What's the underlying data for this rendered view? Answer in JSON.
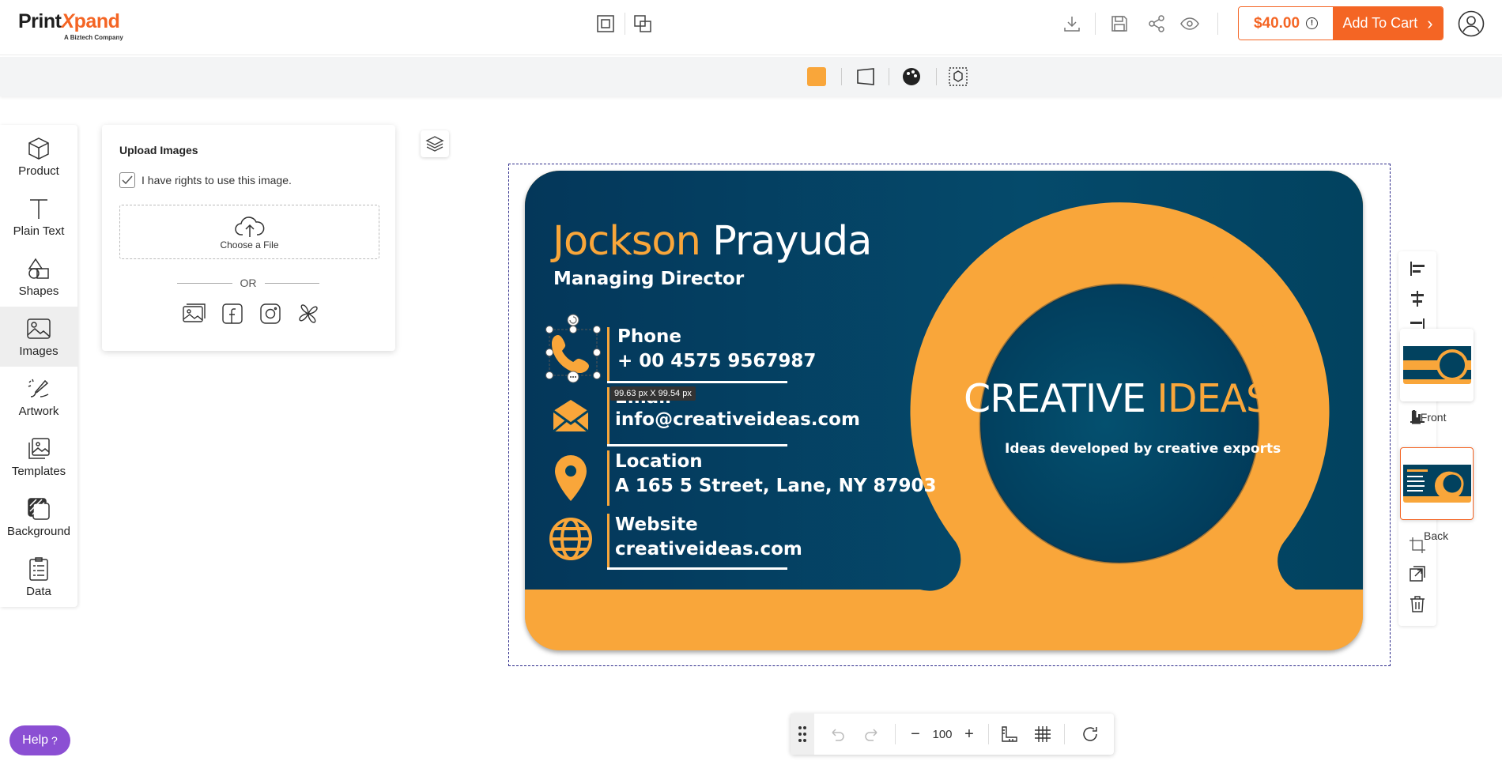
{
  "app": {
    "logo_print": "Print",
    "logo_x": "X",
    "logo_pand": "pand",
    "logo_sub": "A Biztech Company"
  },
  "header": {
    "price": "$40.00",
    "info_mark": "!",
    "cart_label": "Add To Cart",
    "cart_chevron": "›"
  },
  "sidebar": {
    "items": [
      {
        "label": "Product",
        "icon": "cube-icon"
      },
      {
        "label": "Plain Text",
        "icon": "text-icon"
      },
      {
        "label": "Shapes",
        "icon": "shapes-icon"
      },
      {
        "label": "Images",
        "icon": "image-icon"
      },
      {
        "label": "Artwork",
        "icon": "artwork-icon"
      },
      {
        "label": "Templates",
        "icon": "templates-icon"
      },
      {
        "label": "Background",
        "icon": "background-icon"
      },
      {
        "label": "Data",
        "icon": "data-icon"
      }
    ],
    "active": "Images"
  },
  "upload": {
    "title": "Upload Images",
    "rights_label": "I have rights to use this image.",
    "rights_checked": true,
    "choose_label": "Choose a File",
    "or_label": "OR"
  },
  "card": {
    "first_name": "Jockson",
    "last_name": "Prayuda",
    "job_title": "Managing Director",
    "phone_label": "Phone",
    "phone_value": "+ 00 4575 9567987",
    "email_label": "Email",
    "email_value": "info@creativeideas.com",
    "location_label": "Location",
    "location_value": "A 165 5 Street, Lane, NY 87903",
    "website_label": "Website",
    "website_value": "creativeideas.com",
    "headline_1": "CREATIVE",
    "headline_2": "IDEAS",
    "tagline": "Ideas developed by creative exports",
    "navy": "#02425f",
    "orange": "#f9a63a"
  },
  "selection": {
    "size_tip": "99.63 px X 99.54 px"
  },
  "sides": {
    "front_label": "Front",
    "back_label": "Back"
  },
  "zoom": {
    "minus": "−",
    "value": "100",
    "plus": "+"
  },
  "help": {
    "label": "Help",
    "mark": "?"
  },
  "colors": {
    "brand": "#f46524",
    "help": "#8b4fd3"
  }
}
